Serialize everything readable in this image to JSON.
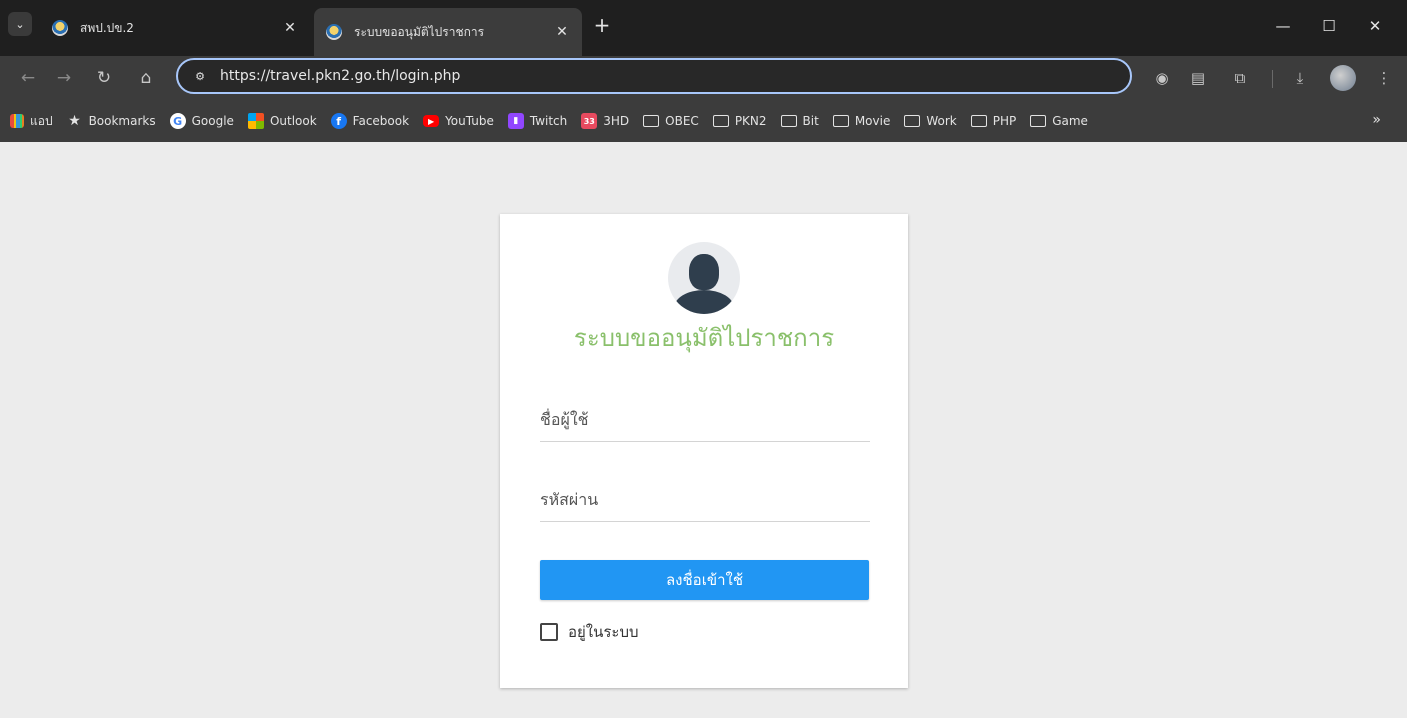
{
  "browser": {
    "tabs": [
      {
        "title": "สพป.ปข.2",
        "active": false
      },
      {
        "title": "ระบบขออนุมัติไปราชการ",
        "active": true
      }
    ],
    "tab_close_glyph": "✕",
    "new_tab_glyph": "+",
    "window_controls": {
      "minimize": "—",
      "maximize": "☐",
      "close": "✕"
    },
    "url": "https://travel.pkn2.go.th/login.php",
    "bookmarks": [
      {
        "label": "แอป",
        "icon": "apps-grid-icon"
      },
      {
        "label": "Bookmarks",
        "icon": "star-icon"
      },
      {
        "label": "Google",
        "icon": "google-icon"
      },
      {
        "label": "Outlook",
        "icon": "outlook-icon"
      },
      {
        "label": "Facebook",
        "icon": "facebook-icon"
      },
      {
        "label": "YouTube",
        "icon": "youtube-icon"
      },
      {
        "label": "Twitch",
        "icon": "twitch-icon"
      },
      {
        "label": "3HD",
        "icon": "3hd-icon"
      },
      {
        "label": "OBEC",
        "icon": "folder-icon"
      },
      {
        "label": "PKN2",
        "icon": "folder-icon"
      },
      {
        "label": "Bit",
        "icon": "folder-icon"
      },
      {
        "label": "Movie",
        "icon": "folder-icon"
      },
      {
        "label": "Work",
        "icon": "folder-icon"
      },
      {
        "label": "PHP",
        "icon": "folder-icon"
      },
      {
        "label": "Game",
        "icon": "folder-icon"
      }
    ],
    "bookmarks_overflow_glyph": "»"
  },
  "login": {
    "title": "ระบบขออนุมัติไปราชการ",
    "username_placeholder": "ชื่อผู้ใช้",
    "password_placeholder": "รหัสผ่าน",
    "submit_label": "ลงชื่อเข้าใช้",
    "remember_label": "อยู่ในระบบ",
    "remember_checked": false
  },
  "colors": {
    "title_green": "#8ac06b",
    "button_blue": "#2196f3",
    "page_background": "#ececec"
  }
}
